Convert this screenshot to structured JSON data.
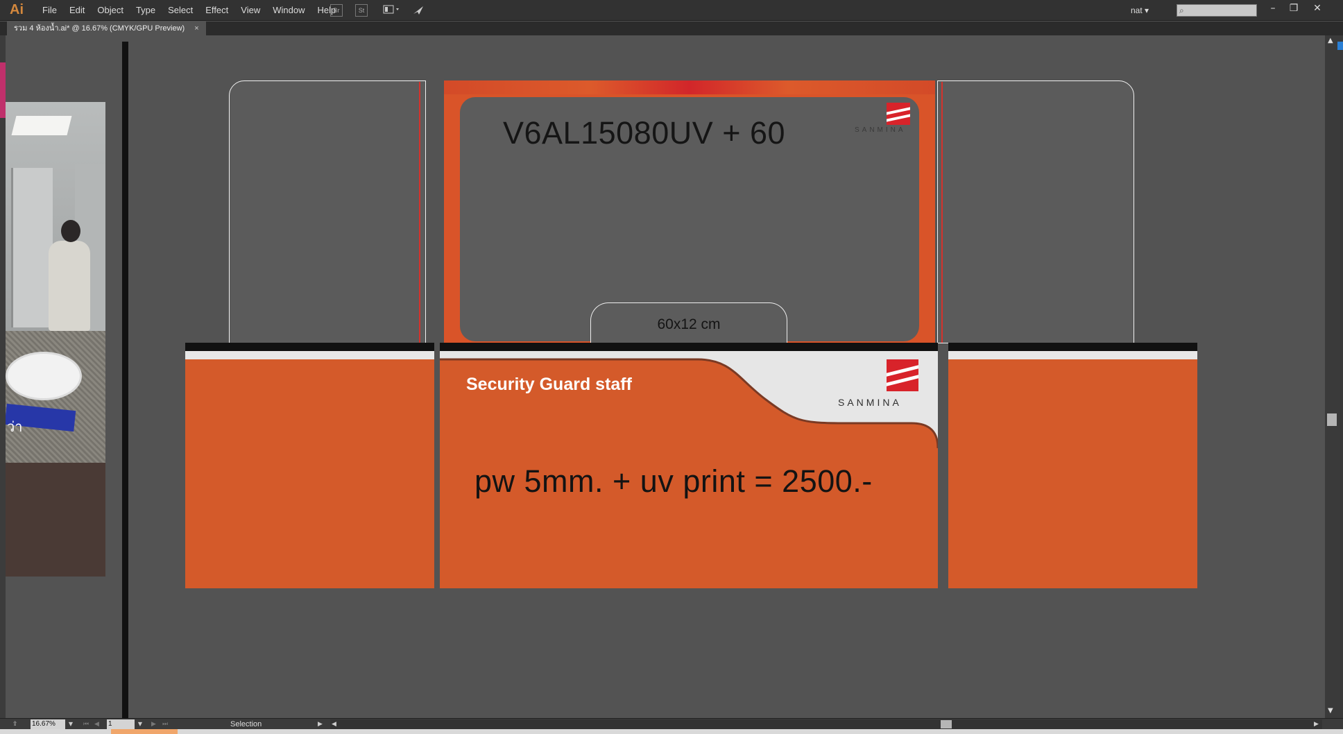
{
  "app": {
    "logo": "Ai"
  },
  "menu": [
    {
      "label": "File"
    },
    {
      "label": "Edit"
    },
    {
      "label": "Object"
    },
    {
      "label": "Type"
    },
    {
      "label": "Select"
    },
    {
      "label": "Effect"
    },
    {
      "label": "View"
    },
    {
      "label": "Window"
    },
    {
      "label": "Help"
    }
  ],
  "toolbar": {
    "br_label": "Br",
    "st_label": "St"
  },
  "workspace": {
    "label": "nat",
    "search_placeholder": ""
  },
  "document_tab": {
    "title": "รวม 4 ห้องน้ำ.ai* @ 16.67% (CMYK/GPU Preview)",
    "close": "×"
  },
  "photo": {
    "caption": "ว่า"
  },
  "artwork": {
    "model_text": "V6AL15080UV + 60",
    "size_text": "60x12 cm",
    "brand_name": "SANMINA",
    "title_text": "Security Guard staff",
    "price_text": "pw 5mm. + uv print = 2500.-"
  },
  "statusbar": {
    "zoom": "16.67%",
    "page": "1",
    "tool": "Selection"
  },
  "colors": {
    "accent_orange": "#d45a2a",
    "brand_red": "#d8232a",
    "ui_dark": "#323232",
    "canvas": "#535353"
  },
  "icons": [
    "workspace-switcher-icon",
    "publish-icon",
    "search-icon",
    "minimize-icon",
    "restore-icon",
    "close-icon"
  ]
}
